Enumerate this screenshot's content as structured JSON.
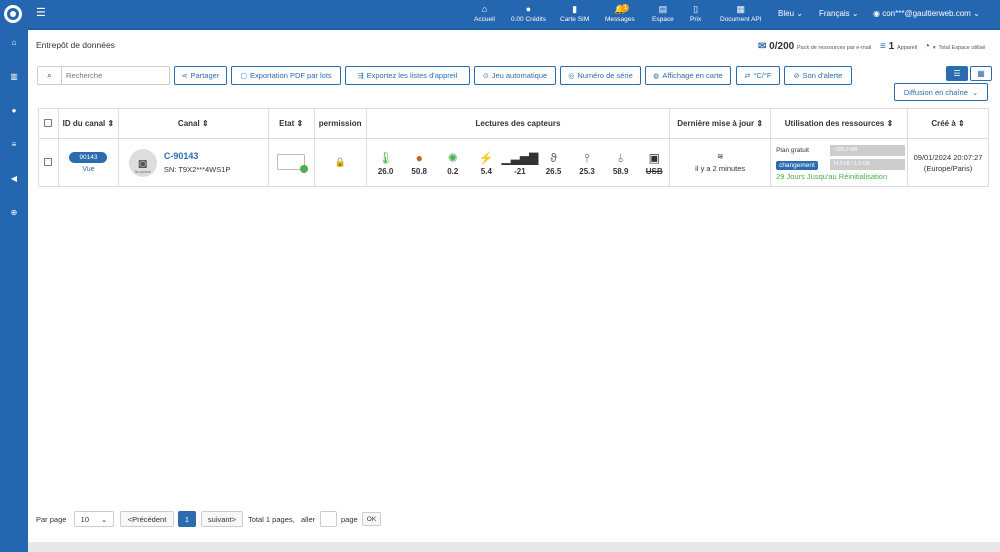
{
  "topbar": {
    "nav": [
      {
        "label": "Accueil",
        "icon": "home-icon"
      },
      {
        "label": "0.00 Crédits",
        "icon": "coins-icon"
      },
      {
        "label": "Carte SIM",
        "icon": "sim-card-icon"
      },
      {
        "label": "Messages",
        "icon": "bell-icon",
        "badge": "1"
      },
      {
        "label": "Espace",
        "icon": "cloud-icon"
      },
      {
        "label": "Prix",
        "icon": "tag-icon"
      },
      {
        "label": "Document API",
        "icon": "document-icon"
      }
    ],
    "theme": "Bleu",
    "language": "Français",
    "user": "con***@gaultierweb.com"
  },
  "sidebar": [
    "home-icon",
    "chart-icon",
    "user-icon",
    "database-icon",
    "megaphone-icon",
    "support-icon"
  ],
  "page": {
    "title": "Entrepôt de données",
    "usage_count": "0/200",
    "usage_label": "Pack de ressources par e-mail",
    "devices_count": "1",
    "devices_label": "Appareil",
    "space_label": "Total Espace utilisé"
  },
  "search": {
    "placeholder": "Recherche"
  },
  "toolbar": [
    {
      "label": "Partager",
      "icon": "share-icon"
    },
    {
      "label": "Exportation PDF par lots",
      "icon": "pdf-icon"
    },
    {
      "label": "Exportez les listes d'appreil",
      "icon": "export-icon"
    },
    {
      "label": "Jeu automatique",
      "icon": "play-icon"
    },
    {
      "label": "Numéro de série",
      "icon": "eye-icon"
    },
    {
      "label": "Affichage en carte",
      "icon": "globe-icon"
    },
    {
      "label": "°C/°F",
      "icon": "swap-icon"
    },
    {
      "label": "Son d'alerte",
      "icon": "mute-icon"
    }
  ],
  "chain_label": "Diffusion en chaîne",
  "table": {
    "headers": [
      "ID du canal",
      "Canal",
      "Etat",
      "permission",
      "Lectures des capteurs",
      "Dernière mise à jour",
      "Utilisation des ressources",
      "Créé à"
    ],
    "row": {
      "id": "90143",
      "vue": "Vue",
      "no_picture": "No picture",
      "name": "C-90143",
      "sn": "SN: T9X2***4WS1P",
      "sensors": [
        {
          "icon": "thermometer-icon",
          "value": "26.0",
          "color": "#4cae4c"
        },
        {
          "icon": "humidity-drop-icon",
          "value": "50.8",
          "color": "#c0622a"
        },
        {
          "icon": "sun-icon",
          "value": "0.2",
          "color": "#4cae4c"
        },
        {
          "icon": "lightning-icon",
          "value": "5.4",
          "color": "#4cae4c"
        },
        {
          "icon": "signal-icon",
          "value": "-21",
          "color": "#333"
        },
        {
          "icon": "probe-icon",
          "value": "26.5",
          "color": "#555"
        },
        {
          "icon": "probe-temp-icon",
          "value": "25.3",
          "color": "#555"
        },
        {
          "icon": "probe-humidity-icon",
          "value": "58.9",
          "color": "#555"
        },
        {
          "icon": "battery-icon",
          "value": "USB",
          "color": "#333"
        }
      ],
      "updated": "il y a 2 minutes",
      "plan": "Plan gratuit",
      "plan_bar": "~200.0 MB",
      "change_label": "changement",
      "space_bar": "14.5 kB / 1.0 GB",
      "reset": "29 Jours Jusqu'au Réinitialisation",
      "created_date": "09/01/2024 20:07:27",
      "created_tz": "(Europe/Paris)"
    }
  },
  "pagination": {
    "per_page_label": "Par page",
    "per_page": "10",
    "prev": "<Précédent",
    "page": "1",
    "next": "suivant>",
    "total": "Total 1 pages,",
    "goto": "aller",
    "page_word": "page",
    "ok": "OK"
  }
}
